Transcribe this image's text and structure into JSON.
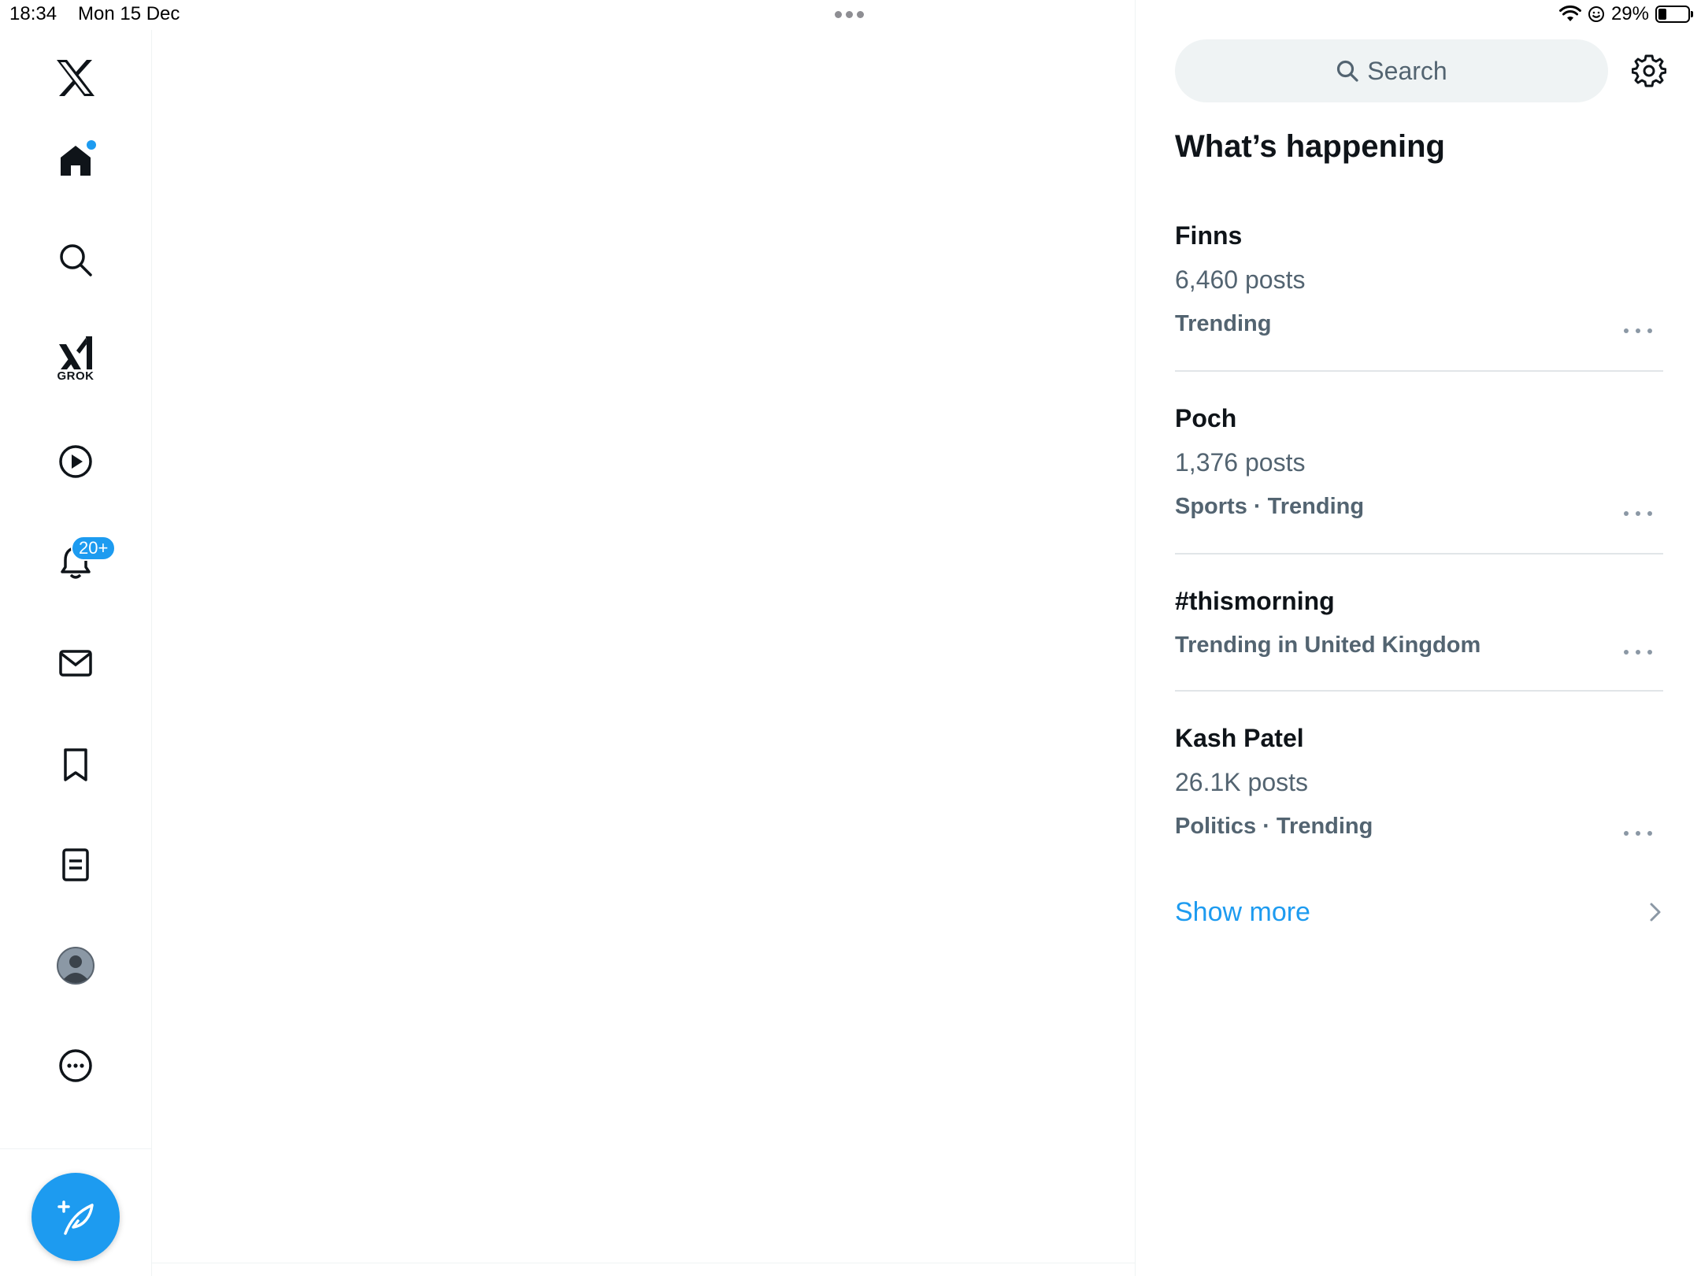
{
  "status_bar": {
    "time": "18:34",
    "date": "Mon 15 Dec",
    "battery": "29%",
    "battery_level": 0.29
  },
  "sidebar": {
    "notifications_badge": "20+",
    "grok_label": "GROK",
    "items": [
      "x-logo-icon",
      "home-icon",
      "search-icon",
      "grok-icon",
      "video-icon",
      "bell-icon",
      "mail-icon",
      "bookmark-icon",
      "article-icon",
      "avatar",
      "more-icon"
    ]
  },
  "right": {
    "search_placeholder": "Search",
    "section_title": "What’s happening",
    "trends": [
      {
        "name": "Finns",
        "posts": "6,460 posts",
        "meta": "Trending"
      },
      {
        "name": "Poch",
        "posts": "1,376 posts",
        "meta": "Sports · Trending"
      },
      {
        "name": "#thismorning",
        "meta": "Trending in United Kingdom"
      },
      {
        "name": "Kash Patel",
        "posts": "26.1K posts",
        "meta": "Politics · Trending"
      }
    ],
    "show_more": "Show more"
  },
  "colors": {
    "accent": "#1d9bf0",
    "text_primary": "#0f1419",
    "text_secondary": "#536471",
    "search_bg": "#eff3f4"
  }
}
